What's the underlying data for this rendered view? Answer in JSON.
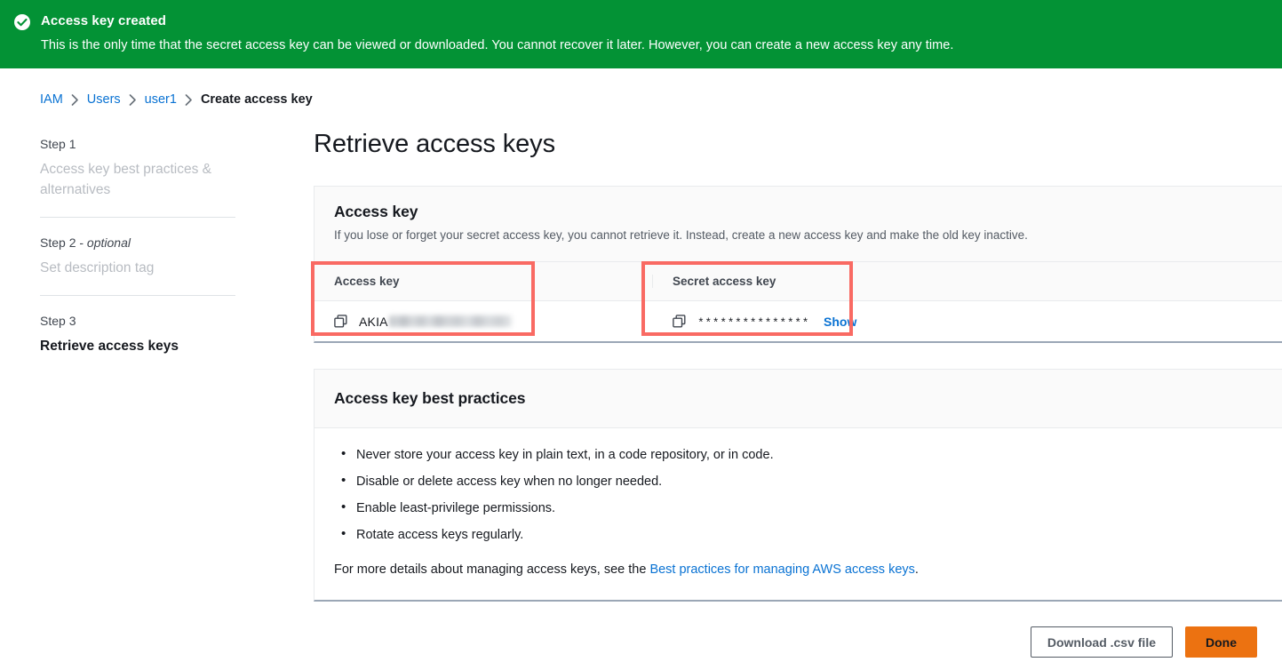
{
  "flash": {
    "icon": "check-circle-icon",
    "title": "Access key created",
    "description": "This is the only time that the secret access key can be viewed or downloaded. You cannot recover it later. However, you can create a new access key any time.",
    "background_color": "#039235"
  },
  "breadcrumb": {
    "separator": "›",
    "items": [
      {
        "label": "IAM",
        "is_link": true
      },
      {
        "label": "Users",
        "is_link": true
      },
      {
        "label": "user1",
        "is_link": true
      },
      {
        "label": "Create access key",
        "is_link": false
      }
    ]
  },
  "wizard": {
    "steps": [
      {
        "number": "Step 1",
        "optional": "",
        "title": "Access key best practices & alternatives",
        "state": "completed"
      },
      {
        "number": "Step 2 - ",
        "optional": "optional",
        "title": "Set description tag",
        "state": "completed"
      },
      {
        "number": "Step 3",
        "optional": "",
        "title": "Retrieve access keys",
        "state": "active"
      }
    ]
  },
  "main": {
    "page_title": "Retrieve access keys",
    "access_key_card": {
      "title": "Access key",
      "description": "If you lose or forget your secret access key, you cannot retrieve it. Instead, create a new access key and make the old key inactive.",
      "columns": [
        {
          "header": "Access key"
        },
        {
          "header": "Secret access key"
        }
      ],
      "row": {
        "access_key_copy_icon": "copy-icon",
        "access_key_prefix": "AKIA",
        "access_key_masked": true,
        "secret_key_copy_icon": "copy-icon",
        "secret_key_mask": "***************",
        "show_link": "Show"
      },
      "highlight_color": "#f96a63"
    },
    "best_practices_card": {
      "title": "Access key best practices",
      "bullets": [
        "Never store your access key in plain text, in a code repository, or in code.",
        "Disable or delete access key when no longer needed.",
        "Enable least-privilege permissions.",
        "Rotate access keys regularly."
      ],
      "footer_prefix": "For more details about managing access keys, see the ",
      "footer_link": "Best practices for managing AWS access keys",
      "footer_suffix": "."
    }
  },
  "footer": {
    "download_label": "Download .csv file",
    "done_label": "Done",
    "primary_color": "#ec7211"
  },
  "colors": {
    "link": "#0972d3",
    "text": "#16191f",
    "muted": "#545b64",
    "disabled": "#b8bcc2",
    "border": "#e9ebed"
  }
}
